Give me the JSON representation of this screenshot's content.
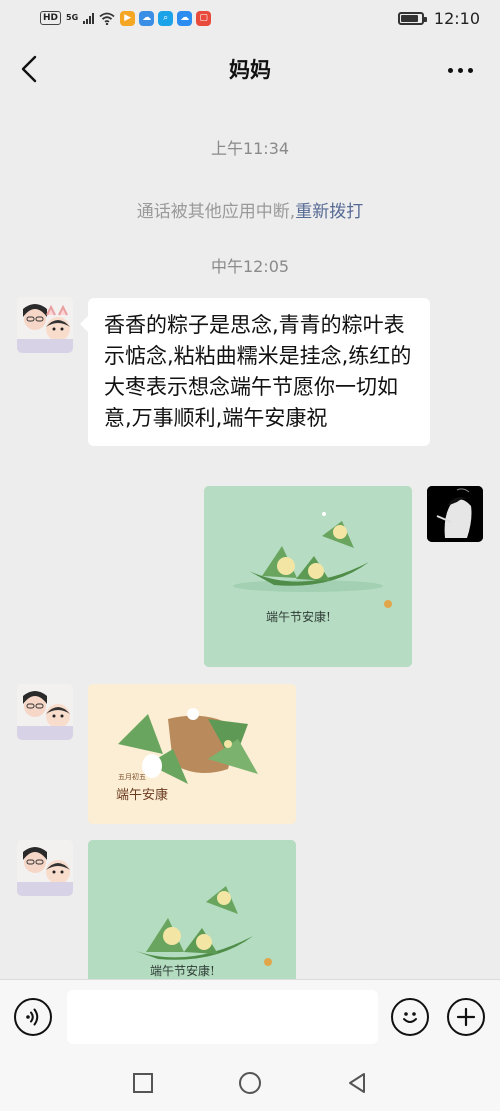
{
  "status_bar": {
    "time": "12:10",
    "network_badge": "HD",
    "network_type": "5G",
    "app_icons": [
      {
        "name": "video-app-icon",
        "color": "#f5a623",
        "glyph": "▶"
      },
      {
        "name": "cloud-app-icon",
        "color": "#3a8ee6",
        "glyph": "☁"
      },
      {
        "name": "search-app-icon",
        "color": "#1aa3e8",
        "glyph": "⌕"
      },
      {
        "name": "weather-app-icon",
        "color": "#2d8cf0",
        "glyph": "☁"
      },
      {
        "name": "red-app-icon",
        "color": "#e84a3c",
        "glyph": "▢"
      }
    ],
    "battery_level": 0.85
  },
  "header": {
    "title": "妈妈",
    "back_icon": "chevron-left-icon",
    "more_icon": "more-dots-icon"
  },
  "chat": {
    "timestamp_1": "上午11:34",
    "call_notice": {
      "text": "通话被其他应用中断,",
      "action": "重新拨打"
    },
    "timestamp_2": "中午12:05",
    "messages": [
      {
        "sender": "mom",
        "type": "text",
        "text": "香香的粽子是思念,青青的粽叶表示惦念,粘粘曲糯米是挂念,练红的大枣表示想念端午节愿你一切如意,万事顺利,端午安康祝"
      },
      {
        "sender": "me",
        "type": "image",
        "caption": "端午节安康!"
      },
      {
        "sender": "mom",
        "type": "image",
        "caption_small": "五月初五",
        "caption": "端午安康"
      },
      {
        "sender": "mom",
        "type": "image",
        "caption": "端午节安康!"
      }
    ]
  },
  "input_bar": {
    "placeholder": "",
    "voice_icon": "voice-icon",
    "emoji_icon": "emoji-icon",
    "plus_icon": "plus-icon"
  },
  "system_nav": {
    "recent_icon": "square-icon",
    "home_icon": "circle-icon",
    "back_icon": "triangle-back-icon"
  },
  "colors": {
    "background": "#ededed",
    "bubble": "#ffffff",
    "link": "#576b95",
    "greeting_green": "#b3dcc0",
    "greeting_cream": "#fbeed4"
  }
}
